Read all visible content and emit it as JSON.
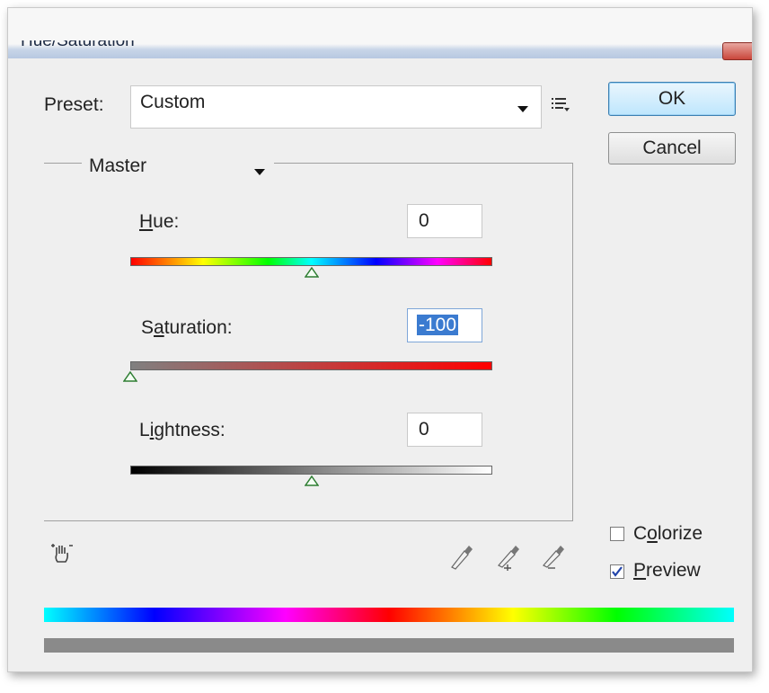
{
  "window": {
    "title": "Hue/Saturation"
  },
  "preset": {
    "label": "Preset:",
    "value": "Custom",
    "menu_icon": "preset-options-icon"
  },
  "buttons": {
    "ok": "OK",
    "cancel": "Cancel"
  },
  "channel": {
    "value": "Master"
  },
  "sliders": {
    "hue": {
      "label": "Hue:",
      "value": "0",
      "level": 0.5
    },
    "saturation": {
      "label": "Saturation:",
      "value": "-100",
      "level": 0.0
    },
    "lightness": {
      "label": "Lightness:",
      "value": "0",
      "level": 0.5
    }
  },
  "options": {
    "colorize": {
      "label": "Colorize",
      "checked": false
    },
    "preview": {
      "label": "Preview",
      "checked": true
    }
  },
  "icons": [
    "targeted-adjustment-hand-icon",
    "eyedropper-icon",
    "eyedropper-plus-icon",
    "eyedropper-minus-icon"
  ],
  "colors": {
    "selection": "#3b7bd0",
    "ok_button_accent": "#3c7fb1",
    "thumb": "#2e7d32"
  }
}
